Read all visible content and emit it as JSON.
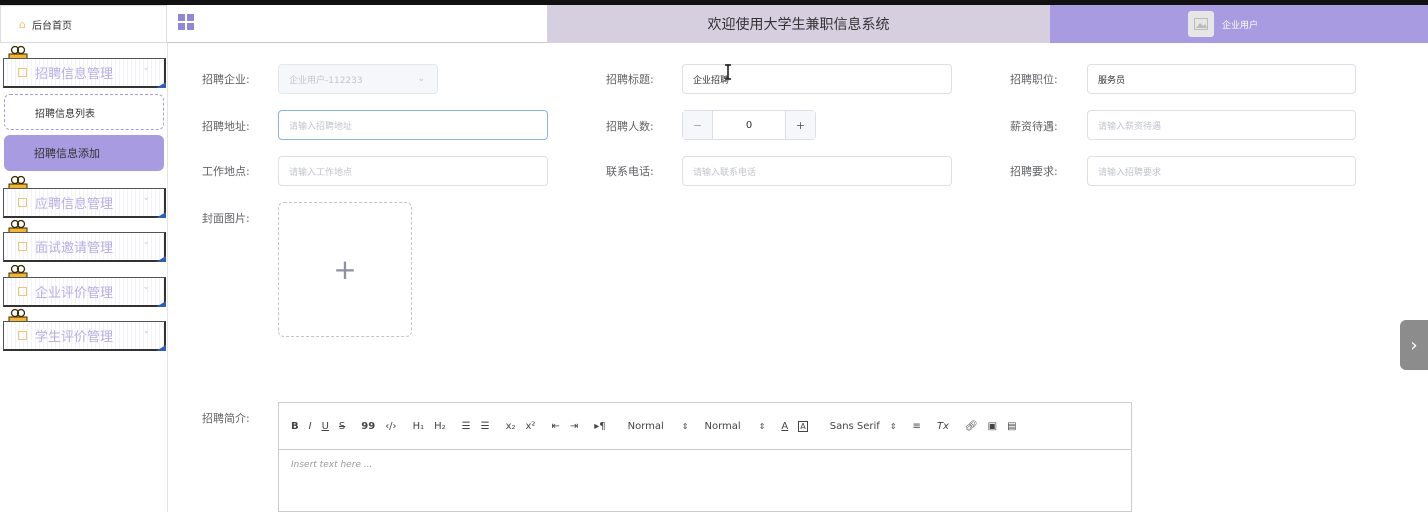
{
  "header": {
    "home_tab": "后台首页",
    "system_title": "欢迎使用大学生兼职信息系统",
    "user_name": "企业用户"
  },
  "sidebar": {
    "menus": [
      {
        "label": "招聘信息管理"
      },
      {
        "label": "应聘信息管理"
      },
      {
        "label": "面试邀请管理"
      },
      {
        "label": "企业评价管理"
      },
      {
        "label": "学生评价管理"
      }
    ],
    "sub_items": [
      {
        "label": "招聘信息列表"
      },
      {
        "label": "招聘信息添加"
      }
    ]
  },
  "form": {
    "company": {
      "label": "招聘企业:",
      "value": "企业用户-112233"
    },
    "title": {
      "label": "招聘标题:",
      "value": "企业招聘"
    },
    "position": {
      "label": "招聘职位:",
      "value": "服务员"
    },
    "address": {
      "label": "招聘地址:",
      "placeholder": "请输入招聘地址"
    },
    "headcount": {
      "label": "招聘人数:",
      "value": "0",
      "minus": "−",
      "plus": "+"
    },
    "salary": {
      "label": "薪资待遇:",
      "placeholder": "请输入薪资待遇"
    },
    "location": {
      "label": "工作地点:",
      "placeholder": "请输入工作地点"
    },
    "phone": {
      "label": "联系电话:",
      "placeholder": "请输入联系电话"
    },
    "requirements": {
      "label": "招聘要求:",
      "placeholder": "请输入招聘要求"
    },
    "cover": {
      "label": "封面图片:",
      "plus": "+"
    },
    "intro": {
      "label": "招聘简介:",
      "placeholder": "Insert text here ..."
    }
  },
  "editor_toolbar": {
    "bold": "B",
    "italic": "I",
    "underline": "U",
    "strike": "S",
    "quote": "99",
    "code": "‹/›",
    "h1": "H₁",
    "h2": "H₂",
    "ol": "☰",
    "ul": "☰",
    "sub": "x₂",
    "sup": "x²",
    "indent_out": "⇤",
    "indent_in": "⇥",
    "direction": "▸¶",
    "size": "Normal",
    "header": "Normal",
    "font": "Sans Serif",
    "align": "≡",
    "clean": "Tx"
  },
  "colors": {
    "accent": "#a99be2",
    "title_bg": "#d6cfe0"
  }
}
